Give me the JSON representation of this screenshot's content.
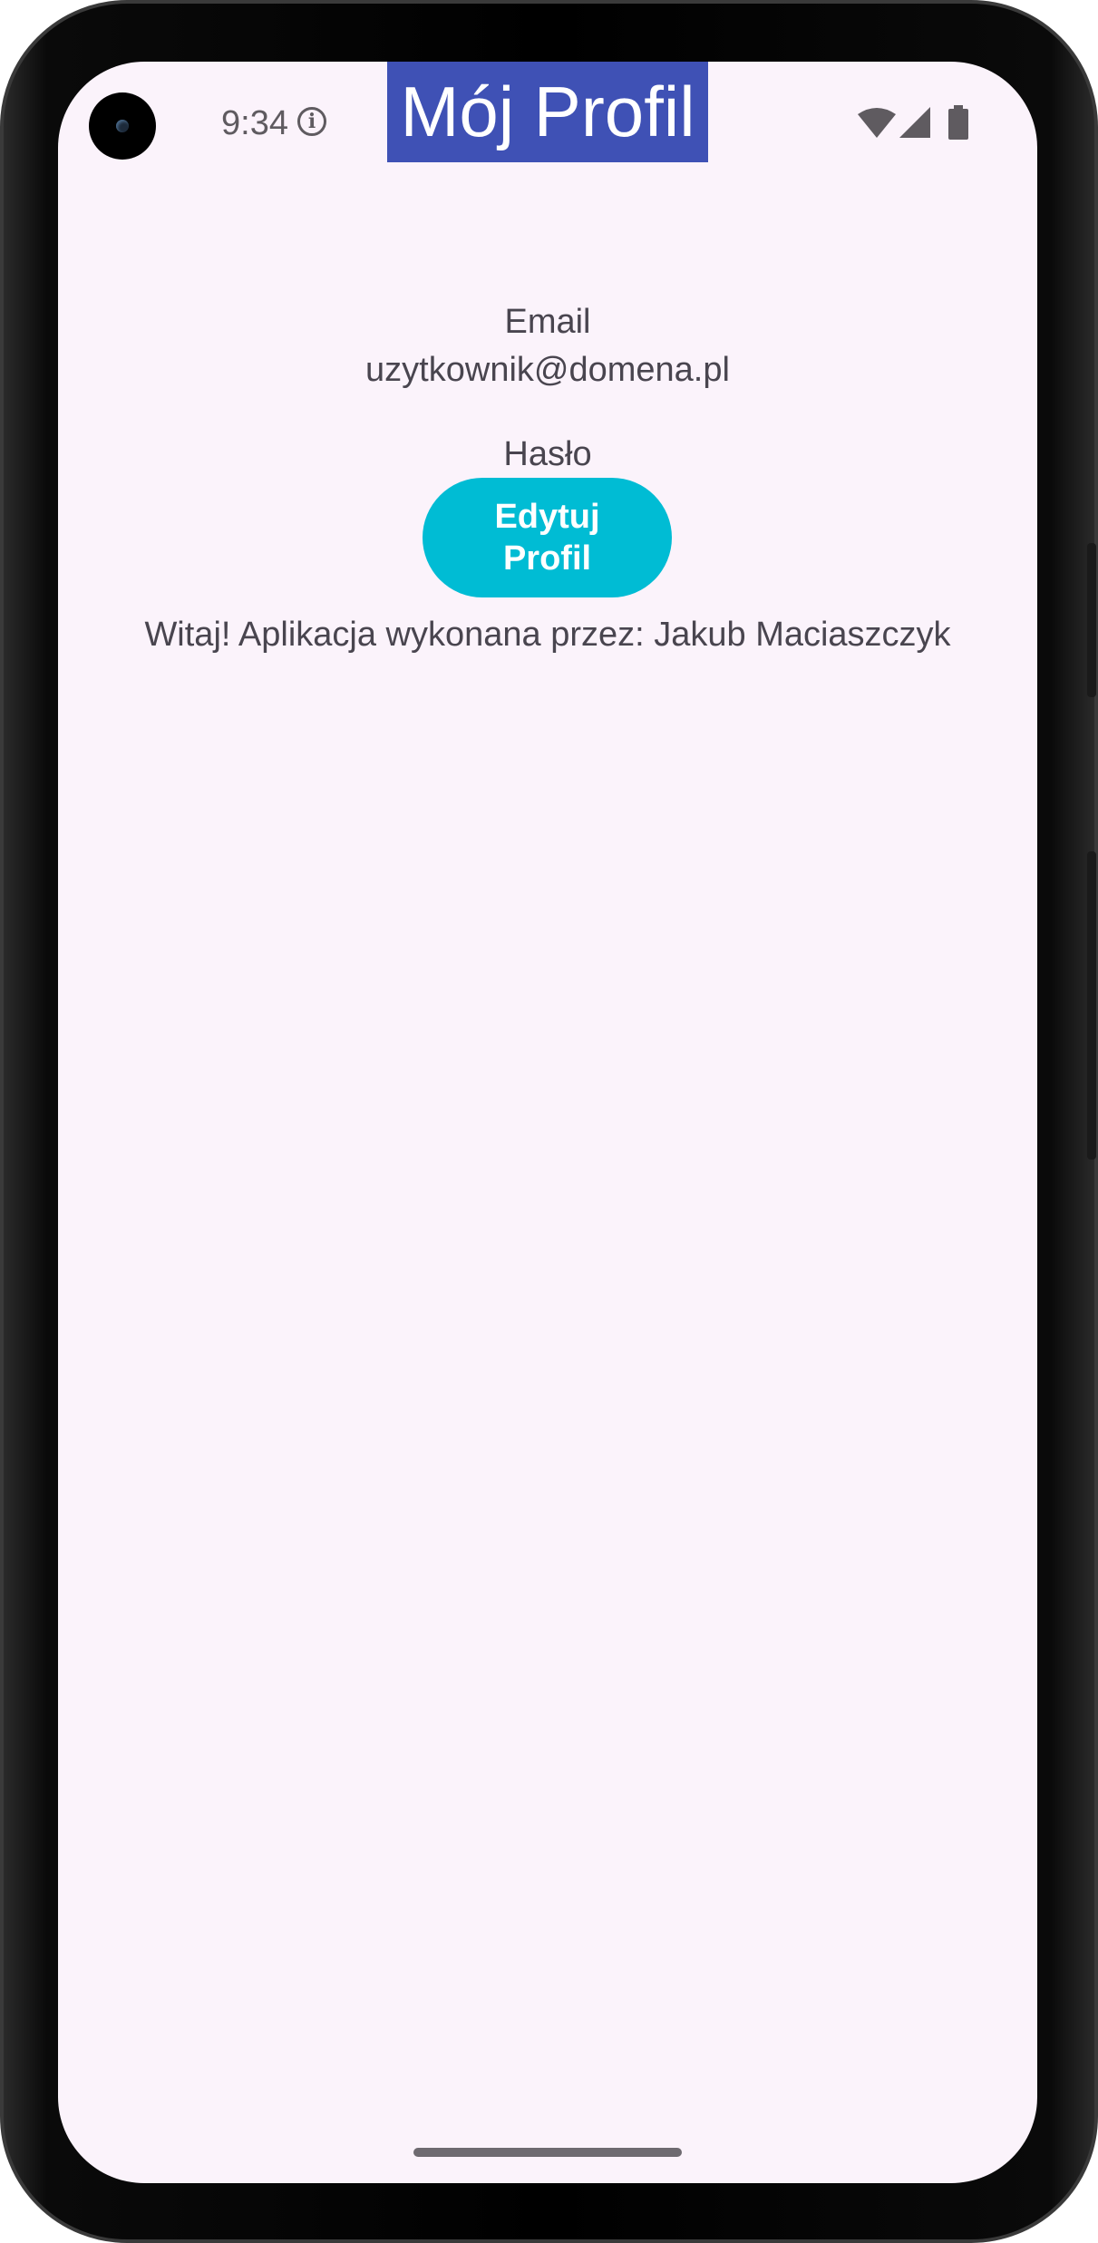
{
  "status_bar": {
    "time": "9:34",
    "info_icon": "info-icon",
    "wifi_icon": "wifi-icon",
    "signal_icon": "cellular-signal-icon",
    "battery_icon": "battery-icon"
  },
  "app_bar": {
    "title": "Mój Profil",
    "background_color": "#3f51b5"
  },
  "profile": {
    "email_label": "Email",
    "email_value": "uzytkownik@domena.pl",
    "password_label": "Hasło",
    "password_value": "********"
  },
  "edit_button": {
    "label": "Edytuj Profil",
    "color": "#00bcd4"
  },
  "footer_message": "Witaj! Aplikacja wykonana przez: Jakub Maciaszczyk",
  "colors": {
    "screen_background": "#fbf3fb",
    "text": "#49454f"
  }
}
